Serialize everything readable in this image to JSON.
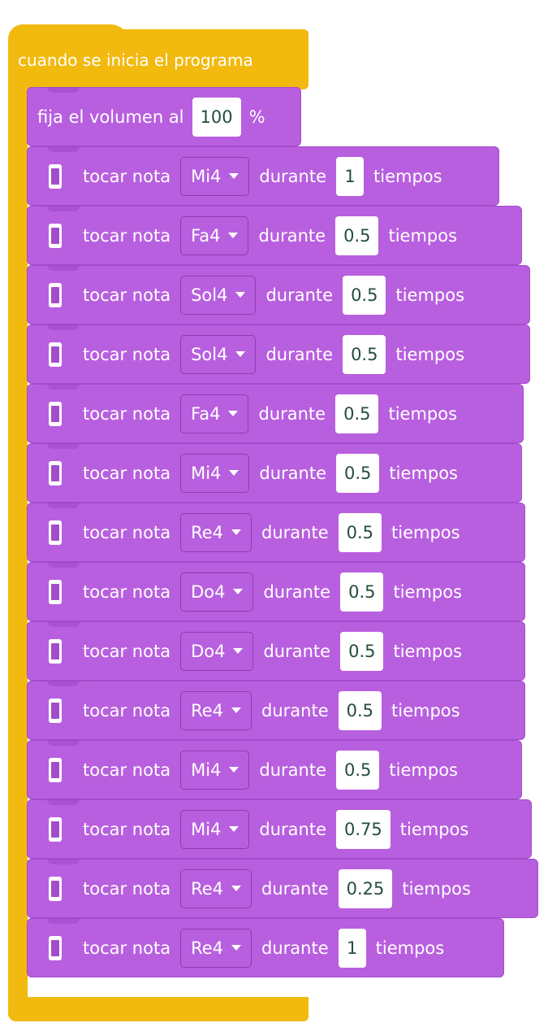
{
  "event_block": {
    "label": "cuando se inicia el programa"
  },
  "volume_block": {
    "label": "fija el volumen al",
    "value": "100",
    "unit": "%"
  },
  "note_blocks": [
    {
      "action": "tocar nota",
      "note": "Mi4",
      "during": "durante",
      "beats": "1",
      "unit": "tiempos"
    },
    {
      "action": "tocar nota",
      "note": "Fa4",
      "during": "durante",
      "beats": "0.5",
      "unit": "tiempos"
    },
    {
      "action": "tocar nota",
      "note": "Sol4",
      "during": "durante",
      "beats": "0.5",
      "unit": "tiempos"
    },
    {
      "action": "tocar nota",
      "note": "Sol4",
      "during": "durante",
      "beats": "0.5",
      "unit": "tiempos"
    },
    {
      "action": "tocar nota",
      "note": "Fa4",
      "during": "durante",
      "beats": "0.5",
      "unit": "tiempos"
    },
    {
      "action": "tocar nota",
      "note": "Mi4",
      "during": "durante",
      "beats": "0.5",
      "unit": "tiempos"
    },
    {
      "action": "tocar nota",
      "note": "Re4",
      "during": "durante",
      "beats": "0.5",
      "unit": "tiempos"
    },
    {
      "action": "tocar nota",
      "note": "Do4",
      "during": "durante",
      "beats": "0.5",
      "unit": "tiempos"
    },
    {
      "action": "tocar nota",
      "note": "Do4",
      "during": "durante",
      "beats": "0.5",
      "unit": "tiempos"
    },
    {
      "action": "tocar nota",
      "note": "Re4",
      "during": "durante",
      "beats": "0.5",
      "unit": "tiempos"
    },
    {
      "action": "tocar nota",
      "note": "Mi4",
      "during": "durante",
      "beats": "0.5",
      "unit": "tiempos"
    },
    {
      "action": "tocar nota",
      "note": "Mi4",
      "during": "durante",
      "beats": "0.75",
      "unit": "tiempos"
    },
    {
      "action": "tocar nota",
      "note": "Re4",
      "during": "durante",
      "beats": "0.25",
      "unit": "tiempos"
    },
    {
      "action": "tocar nota",
      "note": "Re4",
      "during": "durante",
      "beats": "1",
      "unit": "tiempos"
    }
  ],
  "colors": {
    "event": "#f2b90f",
    "sound": "#b85fdf",
    "field_text": "#244e3d"
  },
  "icons": {
    "block_icon": "device-icon",
    "dropdown_icon": "caret-down-icon"
  }
}
